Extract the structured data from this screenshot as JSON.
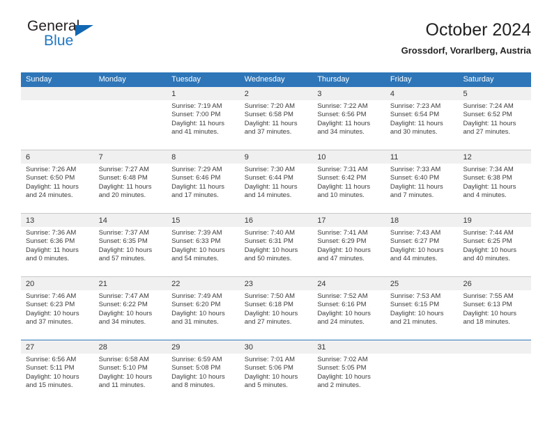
{
  "brand": {
    "name_top": "General",
    "name_bottom": "Blue",
    "triangle_color": "#1267b2",
    "blue_text_color": "#1f77c2"
  },
  "header": {
    "title": "October 2024",
    "location": "Grossdorf, Vorarlberg, Austria"
  },
  "theme": {
    "header_blue": "#2e76b8",
    "daynum_band": "#f0f0f0",
    "grid_line": "#c8c8c8"
  },
  "labels": {
    "sunrise_prefix": "Sunrise:",
    "sunset_prefix": "Sunset:",
    "daylight_prefix": "Daylight:"
  },
  "weekdays": [
    "Sunday",
    "Monday",
    "Tuesday",
    "Wednesday",
    "Thursday",
    "Friday",
    "Saturday"
  ],
  "weeks": [
    {
      "accent_top": false,
      "days": [
        {
          "empty": true
        },
        {
          "empty": true
        },
        {
          "date": "1",
          "sunrise": "Sunrise: 7:19 AM",
          "sunset": "Sunset: 7:00 PM",
          "daylight_a": "Daylight: 11 hours",
          "daylight_b": "and 41 minutes."
        },
        {
          "date": "2",
          "sunrise": "Sunrise: 7:20 AM",
          "sunset": "Sunset: 6:58 PM",
          "daylight_a": "Daylight: 11 hours",
          "daylight_b": "and 37 minutes."
        },
        {
          "date": "3",
          "sunrise": "Sunrise: 7:22 AM",
          "sunset": "Sunset: 6:56 PM",
          "daylight_a": "Daylight: 11 hours",
          "daylight_b": "and 34 minutes."
        },
        {
          "date": "4",
          "sunrise": "Sunrise: 7:23 AM",
          "sunset": "Sunset: 6:54 PM",
          "daylight_a": "Daylight: 11 hours",
          "daylight_b": "and 30 minutes."
        },
        {
          "date": "5",
          "sunrise": "Sunrise: 7:24 AM",
          "sunset": "Sunset: 6:52 PM",
          "daylight_a": "Daylight: 11 hours",
          "daylight_b": "and 27 minutes."
        }
      ]
    },
    {
      "accent_top": false,
      "days": [
        {
          "date": "6",
          "sunrise": "Sunrise: 7:26 AM",
          "sunset": "Sunset: 6:50 PM",
          "daylight_a": "Daylight: 11 hours",
          "daylight_b": "and 24 minutes."
        },
        {
          "date": "7",
          "sunrise": "Sunrise: 7:27 AM",
          "sunset": "Sunset: 6:48 PM",
          "daylight_a": "Daylight: 11 hours",
          "daylight_b": "and 20 minutes."
        },
        {
          "date": "8",
          "sunrise": "Sunrise: 7:29 AM",
          "sunset": "Sunset: 6:46 PM",
          "daylight_a": "Daylight: 11 hours",
          "daylight_b": "and 17 minutes."
        },
        {
          "date": "9",
          "sunrise": "Sunrise: 7:30 AM",
          "sunset": "Sunset: 6:44 PM",
          "daylight_a": "Daylight: 11 hours",
          "daylight_b": "and 14 minutes."
        },
        {
          "date": "10",
          "sunrise": "Sunrise: 7:31 AM",
          "sunset": "Sunset: 6:42 PM",
          "daylight_a": "Daylight: 11 hours",
          "daylight_b": "and 10 minutes."
        },
        {
          "date": "11",
          "sunrise": "Sunrise: 7:33 AM",
          "sunset": "Sunset: 6:40 PM",
          "daylight_a": "Daylight: 11 hours",
          "daylight_b": "and 7 minutes."
        },
        {
          "date": "12",
          "sunrise": "Sunrise: 7:34 AM",
          "sunset": "Sunset: 6:38 PM",
          "daylight_a": "Daylight: 11 hours",
          "daylight_b": "and 4 minutes."
        }
      ]
    },
    {
      "accent_top": false,
      "days": [
        {
          "date": "13",
          "sunrise": "Sunrise: 7:36 AM",
          "sunset": "Sunset: 6:36 PM",
          "daylight_a": "Daylight: 11 hours",
          "daylight_b": "and 0 minutes."
        },
        {
          "date": "14",
          "sunrise": "Sunrise: 7:37 AM",
          "sunset": "Sunset: 6:35 PM",
          "daylight_a": "Daylight: 10 hours",
          "daylight_b": "and 57 minutes."
        },
        {
          "date": "15",
          "sunrise": "Sunrise: 7:39 AM",
          "sunset": "Sunset: 6:33 PM",
          "daylight_a": "Daylight: 10 hours",
          "daylight_b": "and 54 minutes."
        },
        {
          "date": "16",
          "sunrise": "Sunrise: 7:40 AM",
          "sunset": "Sunset: 6:31 PM",
          "daylight_a": "Daylight: 10 hours",
          "daylight_b": "and 50 minutes."
        },
        {
          "date": "17",
          "sunrise": "Sunrise: 7:41 AM",
          "sunset": "Sunset: 6:29 PM",
          "daylight_a": "Daylight: 10 hours",
          "daylight_b": "and 47 minutes."
        },
        {
          "date": "18",
          "sunrise": "Sunrise: 7:43 AM",
          "sunset": "Sunset: 6:27 PM",
          "daylight_a": "Daylight: 10 hours",
          "daylight_b": "and 44 minutes."
        },
        {
          "date": "19",
          "sunrise": "Sunrise: 7:44 AM",
          "sunset": "Sunset: 6:25 PM",
          "daylight_a": "Daylight: 10 hours",
          "daylight_b": "and 40 minutes."
        }
      ]
    },
    {
      "accent_top": false,
      "days": [
        {
          "date": "20",
          "sunrise": "Sunrise: 7:46 AM",
          "sunset": "Sunset: 6:23 PM",
          "daylight_a": "Daylight: 10 hours",
          "daylight_b": "and 37 minutes."
        },
        {
          "date": "21",
          "sunrise": "Sunrise: 7:47 AM",
          "sunset": "Sunset: 6:22 PM",
          "daylight_a": "Daylight: 10 hours",
          "daylight_b": "and 34 minutes."
        },
        {
          "date": "22",
          "sunrise": "Sunrise: 7:49 AM",
          "sunset": "Sunset: 6:20 PM",
          "daylight_a": "Daylight: 10 hours",
          "daylight_b": "and 31 minutes."
        },
        {
          "date": "23",
          "sunrise": "Sunrise: 7:50 AM",
          "sunset": "Sunset: 6:18 PM",
          "daylight_a": "Daylight: 10 hours",
          "daylight_b": "and 27 minutes."
        },
        {
          "date": "24",
          "sunrise": "Sunrise: 7:52 AM",
          "sunset": "Sunset: 6:16 PM",
          "daylight_a": "Daylight: 10 hours",
          "daylight_b": "and 24 minutes."
        },
        {
          "date": "25",
          "sunrise": "Sunrise: 7:53 AM",
          "sunset": "Sunset: 6:15 PM",
          "daylight_a": "Daylight: 10 hours",
          "daylight_b": "and 21 minutes."
        },
        {
          "date": "26",
          "sunrise": "Sunrise: 7:55 AM",
          "sunset": "Sunset: 6:13 PM",
          "daylight_a": "Daylight: 10 hours",
          "daylight_b": "and 18 minutes."
        }
      ]
    },
    {
      "accent_top": true,
      "days": [
        {
          "date": "27",
          "sunrise": "Sunrise: 6:56 AM",
          "sunset": "Sunset: 5:11 PM",
          "daylight_a": "Daylight: 10 hours",
          "daylight_b": "and 15 minutes."
        },
        {
          "date": "28",
          "sunrise": "Sunrise: 6:58 AM",
          "sunset": "Sunset: 5:10 PM",
          "daylight_a": "Daylight: 10 hours",
          "daylight_b": "and 11 minutes."
        },
        {
          "date": "29",
          "sunrise": "Sunrise: 6:59 AM",
          "sunset": "Sunset: 5:08 PM",
          "daylight_a": "Daylight: 10 hours",
          "daylight_b": "and 8 minutes."
        },
        {
          "date": "30",
          "sunrise": "Sunrise: 7:01 AM",
          "sunset": "Sunset: 5:06 PM",
          "daylight_a": "Daylight: 10 hours",
          "daylight_b": "and 5 minutes."
        },
        {
          "date": "31",
          "sunrise": "Sunrise: 7:02 AM",
          "sunset": "Sunset: 5:05 PM",
          "daylight_a": "Daylight: 10 hours",
          "daylight_b": "and 2 minutes."
        },
        {
          "empty": true
        },
        {
          "empty": true
        }
      ]
    }
  ]
}
